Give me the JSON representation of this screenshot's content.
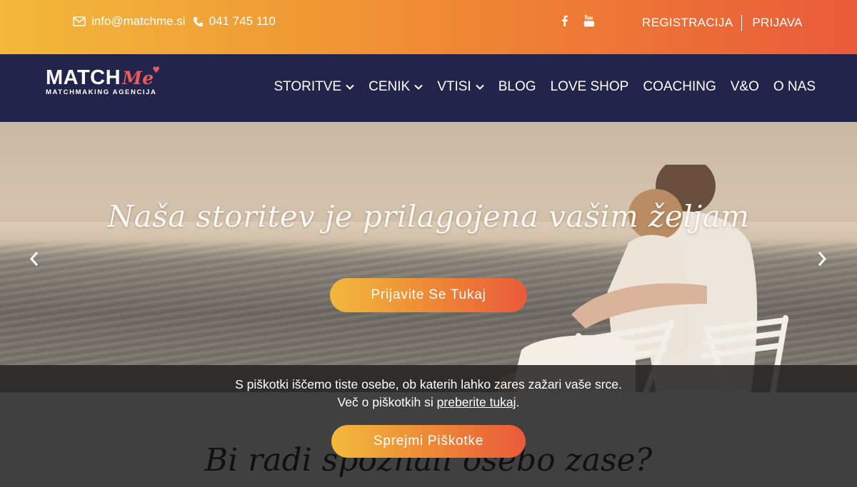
{
  "topbar": {
    "email": "info@matchme.si",
    "phone": "041 745 110",
    "social": [
      "facebook-icon",
      "youtube-icon"
    ],
    "register": "REGISTRACIJA",
    "login": "PRIJAVA",
    "gradient": [
      "#f2b93c",
      "#e95a3a"
    ]
  },
  "logo": {
    "word": "MATCH",
    "accent": "Me",
    "tagline": "MATCHMAKING AGENCIJA"
  },
  "nav": {
    "items": [
      {
        "label": "STORITVE",
        "dropdown": true
      },
      {
        "label": "CENIK",
        "dropdown": true
      },
      {
        "label": "VTISI",
        "dropdown": true
      },
      {
        "label": "BLOG",
        "dropdown": false
      },
      {
        "label": "LOVE SHOP",
        "dropdown": false
      },
      {
        "label": "COACHING",
        "dropdown": false
      },
      {
        "label": "V&O",
        "dropdown": false
      },
      {
        "label": "O NAS",
        "dropdown": false
      }
    ],
    "background": "#23244b"
  },
  "hero": {
    "headline": "Naša storitev je prilagojena vašim željam",
    "cta": "Prijavite Se Tukaj"
  },
  "section": {
    "title": "Bi radi spoznali osebo zase?"
  },
  "cookie": {
    "line1": "S piškotki iščemo tiste osebe, ob katerih lahko zares zažari vaše srce.",
    "line2_prefix": "Več o piškotkih si ",
    "line2_link": "preberite tukaj",
    "line2_suffix": ".",
    "accept": "Sprejmi Piškotke"
  }
}
